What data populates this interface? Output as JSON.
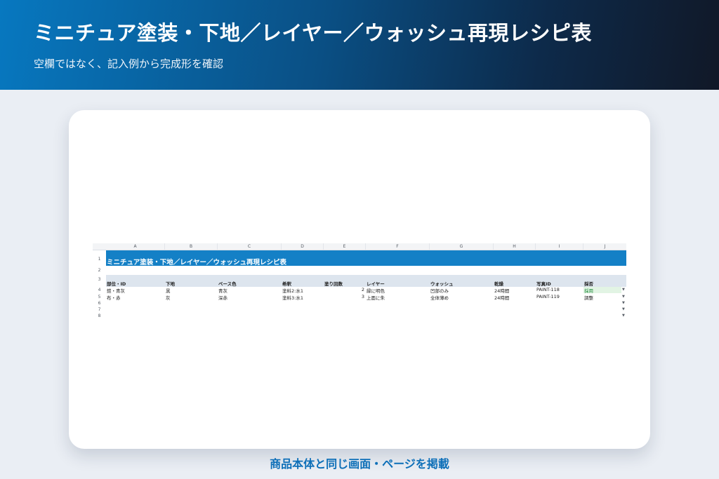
{
  "hero": {
    "title": "ミニチュア塗装・下地／レイヤー／ウォッシュ再現レシピ表",
    "subtitle": "空欄ではなく、記入例から完成形を確認"
  },
  "caption": "商品本体と同じ画面・ページを掲載",
  "sheet": {
    "columns": [
      "A",
      "B",
      "C",
      "D",
      "E",
      "F",
      "G",
      "H",
      "I",
      "J"
    ],
    "row_numbers": [
      "1",
      "2",
      "3",
      "4",
      "5",
      "6",
      "7",
      "8"
    ],
    "title": "ミニチュア塗装・下地／レイヤー／ウォッシュ再現レシピ表",
    "headers": [
      "部位・ID",
      "下地",
      "ベース色",
      "希釈",
      "塗り回数",
      "レイヤー",
      "ウォッシュ",
      "乾燥",
      "写真ID",
      "採否"
    ],
    "rows": [
      [
        "鎧・青灰",
        "黒",
        "青灰",
        "塗料2:水1",
        "2",
        "縁に明色",
        "凹部のみ",
        "24時間",
        "PAINT-118",
        "採用"
      ],
      [
        "布・赤",
        "灰",
        "深赤",
        "塗料3:水1",
        "3",
        "上面に朱",
        "全体薄め",
        "24時間",
        "PAINT-119",
        "調整"
      ]
    ],
    "dropdown_glyph": "▼",
    "colors": {
      "title_band": "#1480c6",
      "header_band": "#dde5ee",
      "adopted_fill": "#e2f4e4"
    }
  }
}
